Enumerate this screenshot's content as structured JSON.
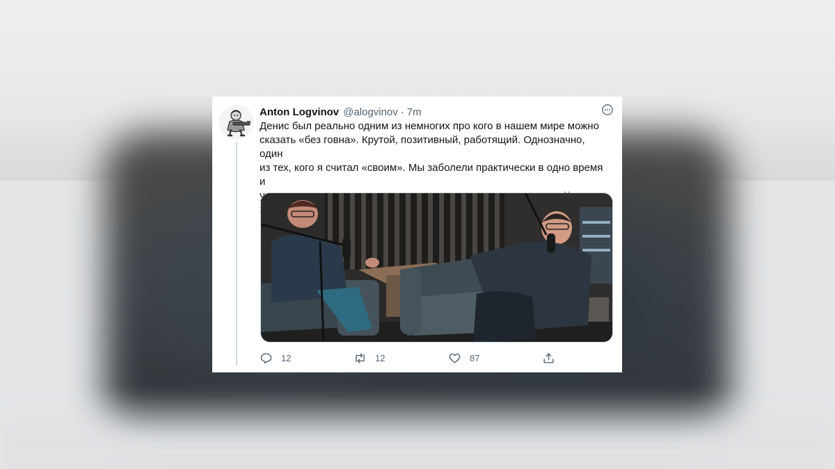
{
  "tweet": {
    "author_name": "Anton Logvinov",
    "author_handle": "@alogvinov",
    "separator": "·",
    "time": "7m",
    "text": "Денис был реально одним из немногих про кого в нашем мире можно\nсказать «без говна». Крутой, позитивный, работящий. Однозначно, один\nиз тех, кого я считал «своим». Мы заболели практически в одно время и\nу него все протекало сложнее, но когда выписали - выдохнул. Какого\nхуя, а?",
    "replies": "12",
    "retweets": "12",
    "likes": "87"
  },
  "icons": {
    "more": "more-icon",
    "reply": "reply-icon",
    "retweet": "retweet-icon",
    "like": "heart-icon",
    "share": "share-icon"
  },
  "colors": {
    "text": "#0f1419",
    "secondary": "#536471",
    "border": "#cfd9de"
  }
}
